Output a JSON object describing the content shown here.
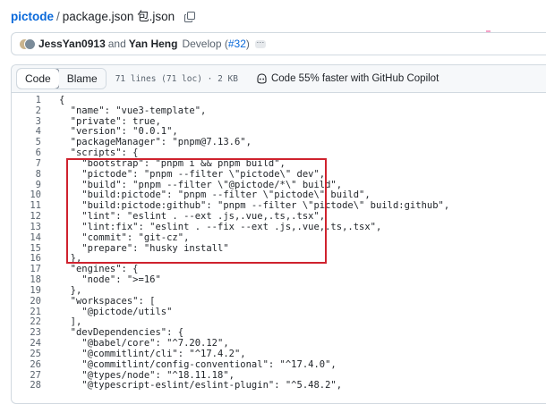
{
  "breadcrumb": {
    "repo": "pictode",
    "separator": "/",
    "file": "package.json 包.json"
  },
  "commit": {
    "author1": "JessYan0913",
    "and": "and",
    "author2": "Yan Heng",
    "message": "Develop",
    "pr_open": "(",
    "pr": "#32",
    "pr_close": ")"
  },
  "file_header": {
    "tabs": [
      "Code",
      "Blame"
    ],
    "meta": "71 lines (71 loc) · 2 KB",
    "copilot": "Code 55% faster with GitHub Copilot"
  },
  "code_lines": [
    {
      "n": "1",
      "text": "{"
    },
    {
      "n": "2",
      "text": "  \"name\": \"vue3-template\","
    },
    {
      "n": "3",
      "text": "  \"private\": true,"
    },
    {
      "n": "4",
      "text": "  \"version\": \"0.0.1\","
    },
    {
      "n": "5",
      "text": "  \"packageManager\": \"pnpm@7.13.6\","
    },
    {
      "n": "6",
      "text": "  \"scripts\": {"
    },
    {
      "n": "7",
      "text": "    \"bootstrap\": \"pnpm i && pnpm build\","
    },
    {
      "n": "8",
      "text": "    \"pictode\": \"pnpm --filter \\\"pictode\\\" dev\","
    },
    {
      "n": "9",
      "text": "    \"build\": \"pnpm --filter \\\"@pictode/*\\\" build\","
    },
    {
      "n": "10",
      "text": "    \"build:pictode\": \"pnpm --filter \\\"pictode\\\" build\","
    },
    {
      "n": "11",
      "text": "    \"build:pictode:github\": \"pnpm --filter \\\"pictode\\\" build:github\","
    },
    {
      "n": "12",
      "text": "    \"lint\": \"eslint . --ext .js,.vue,.ts,.tsx\","
    },
    {
      "n": "13",
      "text": "    \"lint:fix\": \"eslint . --fix --ext .js,.vue,.ts,.tsx\","
    },
    {
      "n": "14",
      "text": "    \"commit\": \"git-cz\","
    },
    {
      "n": "15",
      "text": "    \"prepare\": \"husky install\""
    },
    {
      "n": "16",
      "text": "  },"
    },
    {
      "n": "17",
      "text": "  \"engines\": {"
    },
    {
      "n": "18",
      "text": "    \"node\": \">=16\""
    },
    {
      "n": "19",
      "text": "  },"
    },
    {
      "n": "20",
      "text": "  \"workspaces\": ["
    },
    {
      "n": "21",
      "text": "    \"@pictode/utils\""
    },
    {
      "n": "22",
      "text": "  ],"
    },
    {
      "n": "23",
      "text": "  \"devDependencies\": {"
    },
    {
      "n": "24",
      "text": "    \"@babel/core\": \"^7.20.12\","
    },
    {
      "n": "25",
      "text": "    \"@commitlint/cli\": \"^17.4.2\","
    },
    {
      "n": "26",
      "text": "    \"@commitlint/config-conventional\": \"^17.4.0\","
    },
    {
      "n": "27",
      "text": "    \"@types/node\": \"^18.11.18\","
    },
    {
      "n": "28",
      "text": "    \"@typescript-eslint/eslint-plugin\": \"^5.48.2\","
    }
  ],
  "icons": {
    "copy": "copy-icon",
    "copilot": "copilot-icon",
    "more": "ellipsis-icon"
  },
  "colors": {
    "link": "#0969da",
    "highlight_border": "#cf222e",
    "muted": "#59636e"
  }
}
